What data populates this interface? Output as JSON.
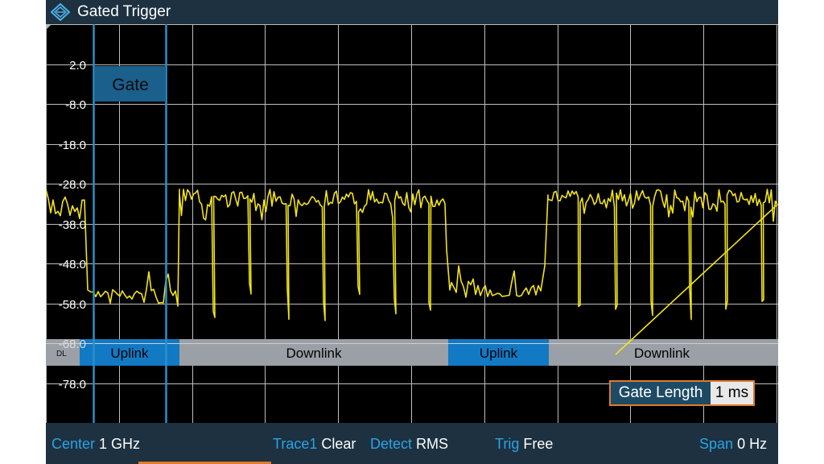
{
  "window": {
    "title": "Gated Trigger",
    "logo_icon": "rs-diamond-logo-icon"
  },
  "colors": {
    "trace": "#f2e31c",
    "gate_line": "#2b8fc9",
    "uplink_bar": "#1279c4",
    "downlink_bar": "#9aa0a6",
    "accent": "#e07b2c",
    "label_blue": "#2aa3e8"
  },
  "plot": {
    "y_tick_labels": [
      "2.0",
      "-8.0",
      "-18.0",
      "-28.0",
      "-38.0",
      "-48.0",
      "-58.0",
      "-68.0",
      "-78.0"
    ],
    "gate_label": "Gate",
    "dl_marker": "DL",
    "segments": [
      {
        "label": "Uplink",
        "kind": "uplink"
      },
      {
        "label": "Downlink",
        "kind": "downlink"
      },
      {
        "label": "Uplink",
        "kind": "uplink"
      },
      {
        "label": "Downlink",
        "kind": "downlink"
      }
    ]
  },
  "gate_length": {
    "label": "Gate Length",
    "value": "1 ms"
  },
  "status": {
    "center_label": "Center",
    "center_value": "1 GHz",
    "trace_label": "Trace1",
    "trace_value": "Clear",
    "detect_label": "Detect",
    "detect_value": "RMS",
    "trig_label": "Trig",
    "trig_value": "Free",
    "span_label": "Span",
    "span_value": "0 Hz"
  }
}
